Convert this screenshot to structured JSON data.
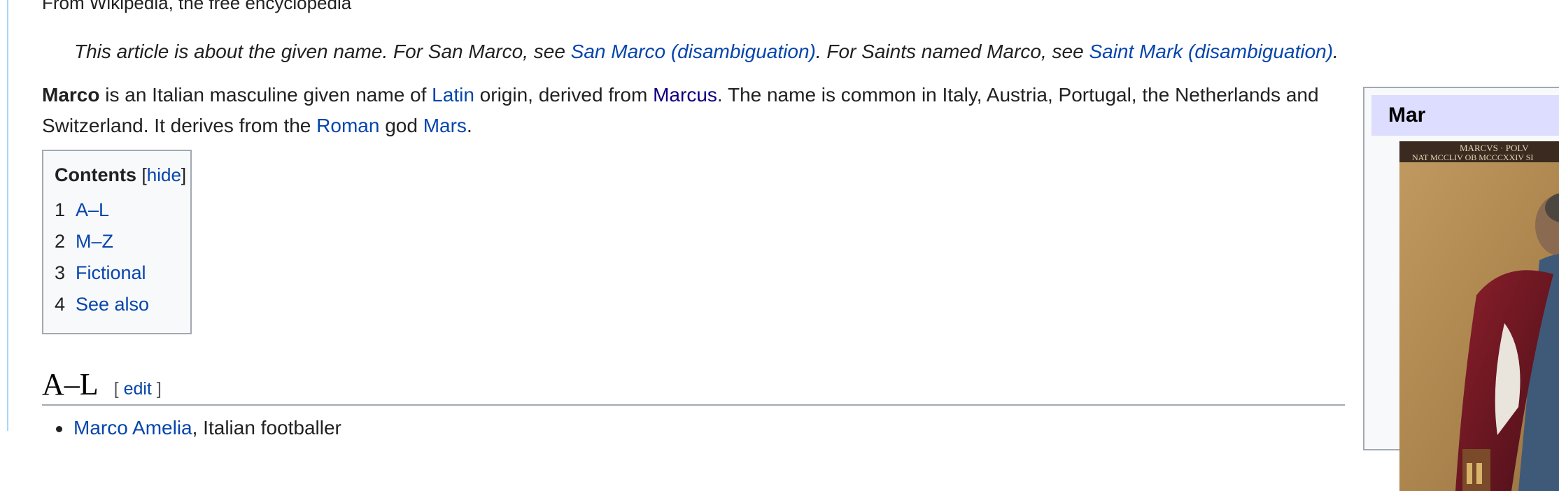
{
  "tagline": "From Wikipedia, the free encyclopedia",
  "hatnote": {
    "text_1": "This article is about the given name. For San Marco, see ",
    "link_1": "San Marco (disambiguation)",
    "text_2": ". For Saints named Marco, see ",
    "link_2": "Saint Mark (disambiguation)",
    "text_3": "."
  },
  "intro": {
    "bold": "Marco",
    "t1": " is an Italian masculine given name of ",
    "link_latin": "Latin",
    "t2": " origin, derived from ",
    "link_marcus": "Marcus",
    "t3": ". The name is common in Italy, Austria, Portugal, the Netherlands and Switzerland. It derives from the ",
    "link_roman": "Roman",
    "t4": " god ",
    "link_mars": "Mars",
    "t5": "."
  },
  "toc": {
    "title": "Contents",
    "open_bracket": "[",
    "hide": "hide",
    "close_bracket": "]",
    "items": [
      {
        "num": "1",
        "label": "A–L"
      },
      {
        "num": "2",
        "label": "M–Z"
      },
      {
        "num": "3",
        "label": "Fictional"
      },
      {
        "num": "4",
        "label": "See also"
      }
    ]
  },
  "section": {
    "title": "A–L",
    "edit_open": "[ ",
    "edit": "edit",
    "edit_close": " ]"
  },
  "list": {
    "first_link": "Marco Amelia",
    "first_text": ", Italian footballer"
  },
  "infobox": {
    "title": "Mar",
    "inscription_1": "MARCVS · POLV",
    "inscription_2": "NAT MCCLIV OB MCCCXXIV SI"
  },
  "colors": {
    "link": "#0645ad",
    "visited": "#0b0080",
    "infobox_header": "#ddddff",
    "toc_bg": "#f8f9fa",
    "border": "#a2a9b1"
  }
}
